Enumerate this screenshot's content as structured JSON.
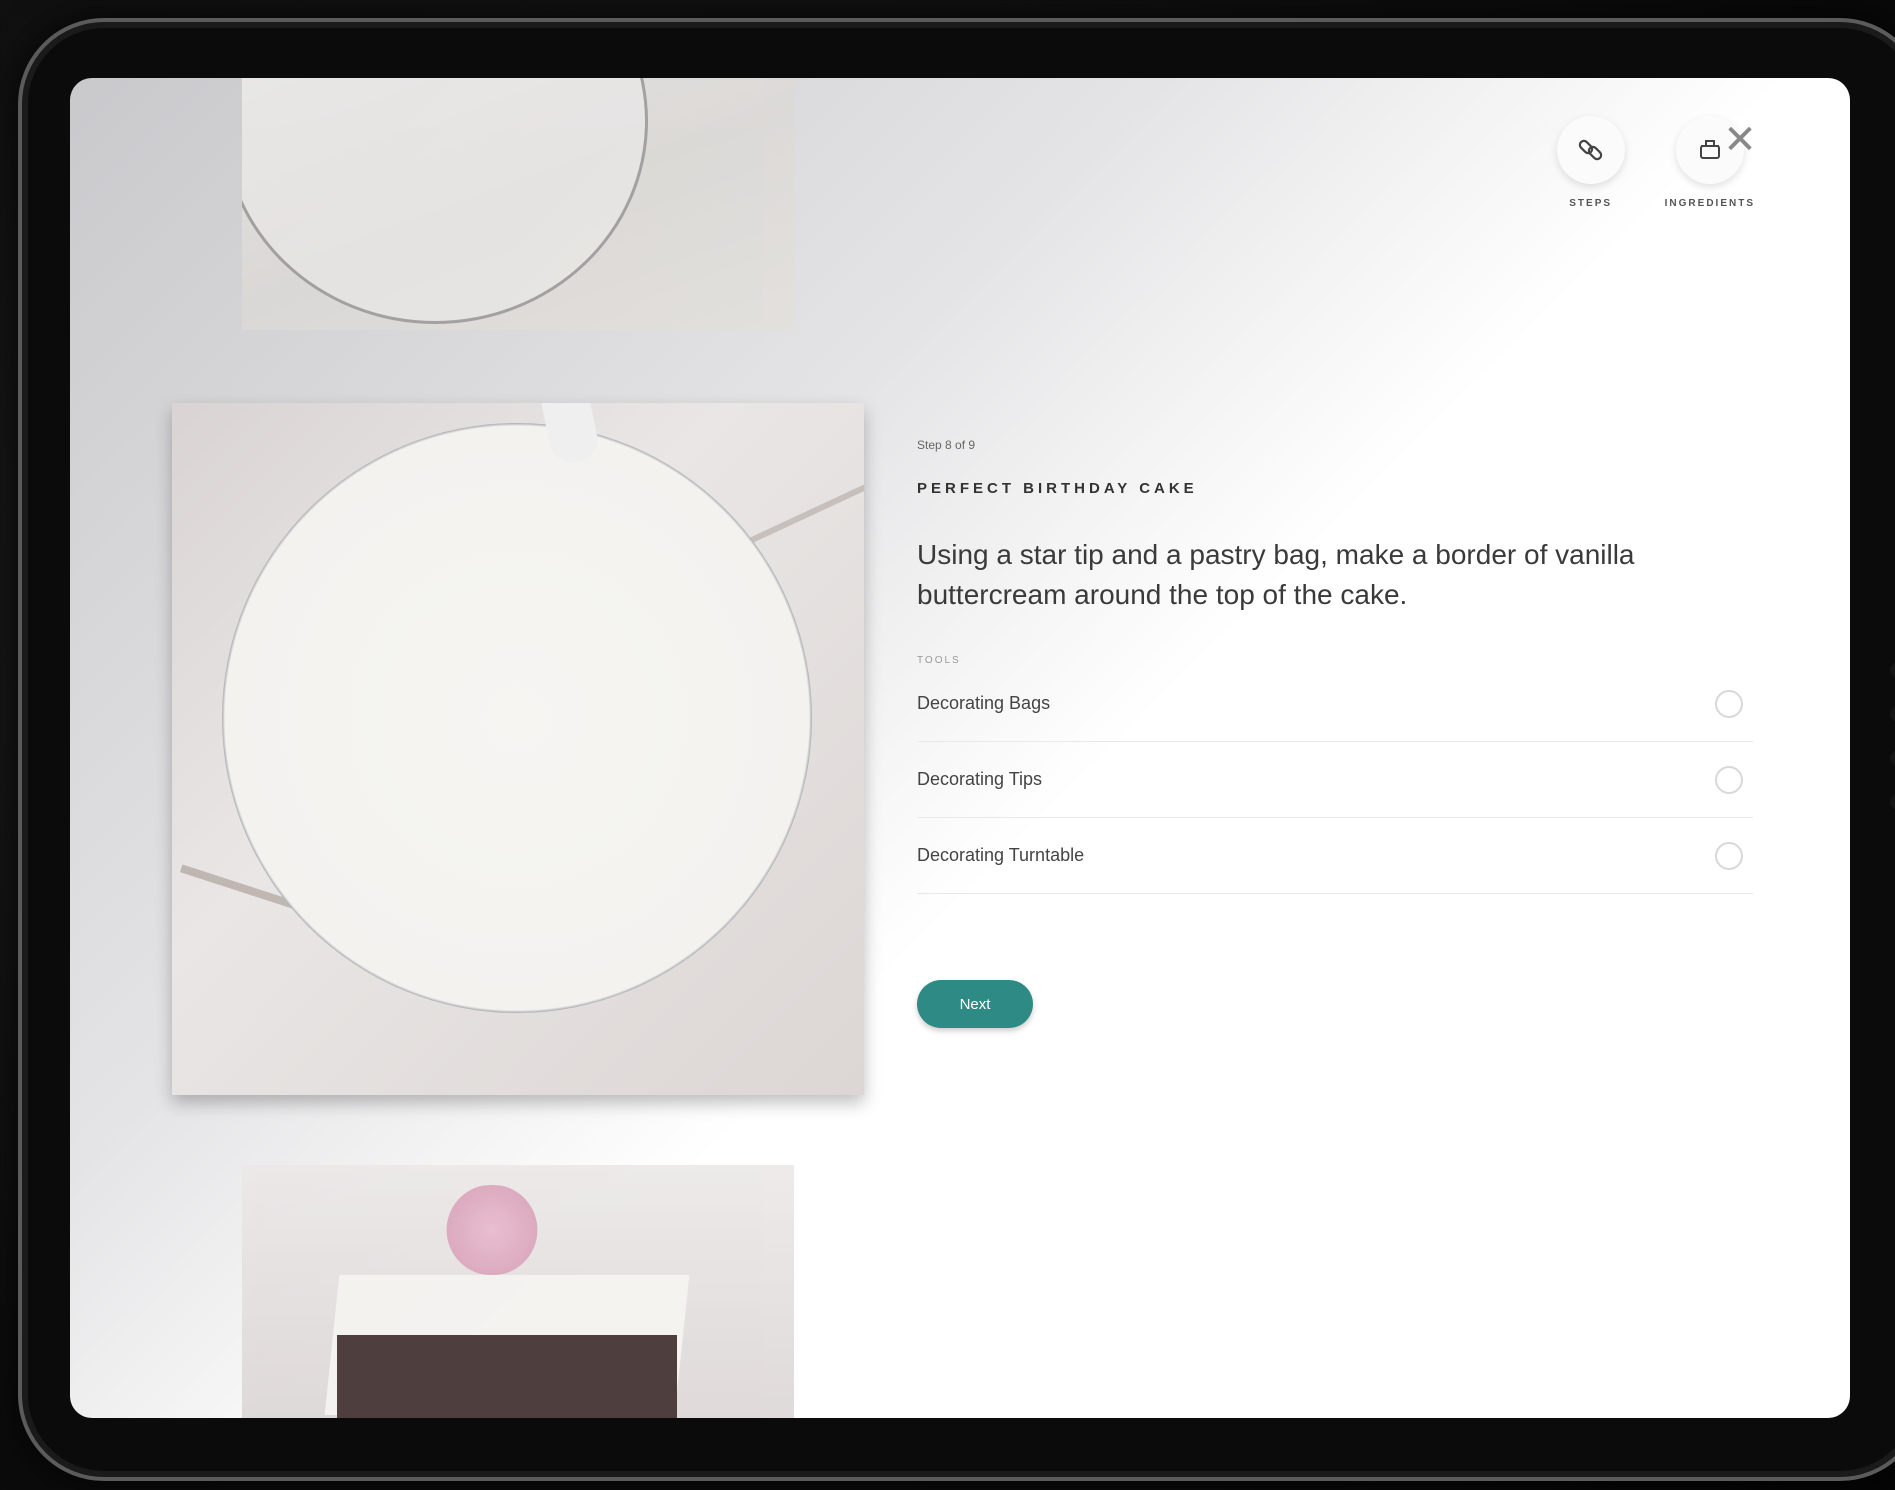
{
  "header": {
    "actions": [
      {
        "label": "STEPS",
        "icon": "link-icon"
      },
      {
        "label": "INGREDIENTS",
        "icon": "container-icon"
      }
    ],
    "close_icon": "close-icon"
  },
  "step": {
    "counter": "Step 8 of 9",
    "recipe_title": "PERFECT BIRTHDAY CAKE",
    "instruction": "Using a star tip and a pastry bag, make a border of vanilla buttercream around the top of the cake."
  },
  "tools": {
    "label": "TOOLS",
    "items": [
      {
        "name": "Decorating Bags"
      },
      {
        "name": "Decorating Tips"
      },
      {
        "name": "Decorating Turntable"
      }
    ]
  },
  "next_label": "Next",
  "colors": {
    "accent": "#2e8a84"
  }
}
